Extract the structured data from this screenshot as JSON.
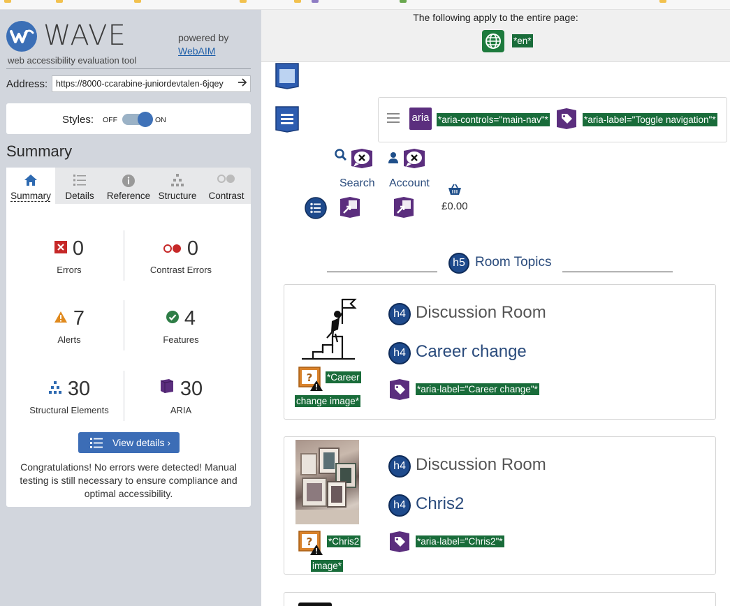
{
  "wave": {
    "brand": "WAVE",
    "subtitle": "web accessibility evaluation tool",
    "powered_by": "powered by",
    "powered_link": "WebAIM",
    "address_label": "Address:",
    "address_value": "https://8000-ccarabine-juniordevtalen-6jqey",
    "styles_label": "Styles:",
    "styles_off": "OFF",
    "styles_on": "ON",
    "styles_enabled": true,
    "summary_title": "Summary",
    "tabs": [
      {
        "label": "Summary",
        "icon": "home-icon",
        "active": true
      },
      {
        "label": "Details",
        "icon": "list-icon",
        "active": false
      },
      {
        "label": "Reference",
        "icon": "info-icon",
        "active": false
      },
      {
        "label": "Structure",
        "icon": "structure-icon",
        "active": false
      },
      {
        "label": "Contrast",
        "icon": "contrast-icon",
        "active": false
      }
    ],
    "stats": {
      "errors": {
        "value": "0",
        "label": "Errors"
      },
      "contrast_errors": {
        "value": "0",
        "label": "Contrast Errors"
      },
      "alerts": {
        "value": "7",
        "label": "Alerts"
      },
      "features": {
        "value": "4",
        "label": "Features"
      },
      "structural": {
        "value": "30",
        "label": "Structural Elements"
      },
      "aria": {
        "value": "30",
        "label": "ARIA"
      }
    },
    "view_details": "View details ›",
    "congrats": "Congratulations! No errors were detected! Manual testing is still necessary to ensure compliance and optimal accessibility."
  },
  "page": {
    "apply_text": "The following apply to the entire page:",
    "lang_tag": "*en*",
    "nav": {
      "aria_badge": "aria",
      "aria_controls": "*aria-controls=\"main-nav\"*",
      "aria_label": "*aria-label=\"Toggle navigation\"*"
    },
    "search_label": "Search",
    "account_label": "Account",
    "basket_price": "£0.00",
    "section": {
      "badge": "h5",
      "title": "Room Topics"
    },
    "cards": [
      {
        "h_badge": "h4",
        "heading": "Discussion Room",
        "sub_badge": "h4",
        "subheading": "Career change",
        "aria_label": "*aria-label=\"Career change\"*",
        "alt_line1": "*Career",
        "alt_line2": "change image*"
      },
      {
        "h_badge": "h4",
        "heading": "Discussion Room",
        "sub_badge": "h4",
        "subheading": "Chris2",
        "aria_label": "*aria-label=\"Chris2\"*",
        "alt_line1": "*Chris2",
        "alt_line2": "image*"
      }
    ]
  },
  "colors": {
    "wave_blue": "#3b6fb6",
    "aria_purple": "#5b2e7e",
    "wave_green": "#196c3a",
    "heading_navy": "#1e4a8c",
    "alert_orange": "#d9822b",
    "error_red": "#c62828"
  }
}
